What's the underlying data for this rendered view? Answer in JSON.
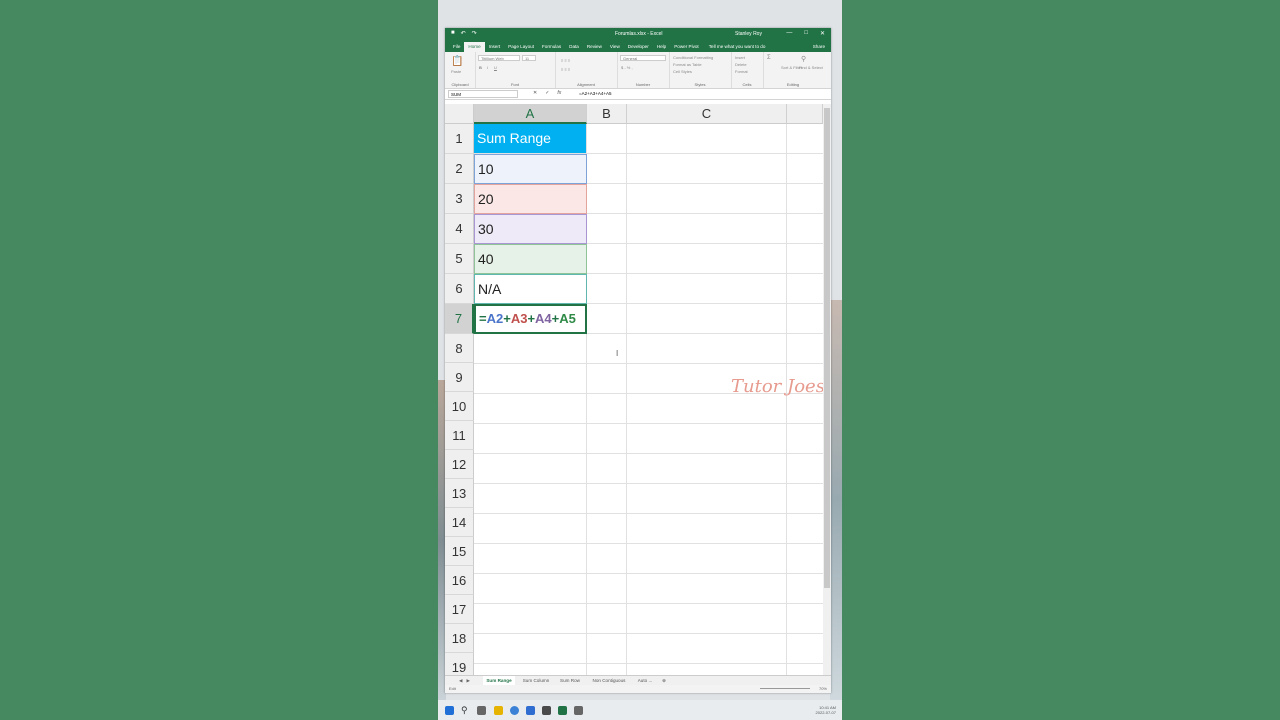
{
  "window": {
    "title": "Forumlas.xlsx - Excel",
    "user": "Stanley Roy",
    "controls": [
      "—",
      "□",
      "✕"
    ]
  },
  "ribbon_tabs": [
    "File",
    "Home",
    "Insert",
    "Page Layout",
    "Formulas",
    "Data",
    "Review",
    "View",
    "Developer",
    "Help",
    "Power Pivot"
  ],
  "active_tab": "Home",
  "tell_me": "Tell me what you want to do",
  "share": "Share",
  "ribbon": {
    "groups": [
      "Clipboard",
      "Font",
      "Alignment",
      "Number",
      "Styles",
      "Cells",
      "Editing"
    ],
    "paste_label": "Paste",
    "font_name": "Titillium Web",
    "font_size": "11",
    "number_format": "General",
    "styles_items": [
      "Conditional Formatting",
      "Format as Table",
      "Cell Styles"
    ],
    "cells_items": [
      "Insert",
      "Delete",
      "Format"
    ],
    "editing_sort": "Sort & Filter",
    "editing_find": "Find & Select"
  },
  "formula_bar": {
    "name_box": "SUM",
    "formula": "=A2+A3+A4+A5"
  },
  "columns": [
    "A",
    "B",
    "C"
  ],
  "rows": [
    "1",
    "2",
    "3",
    "4",
    "5",
    "6",
    "7",
    "8",
    "9",
    "10",
    "11",
    "12",
    "13",
    "14",
    "15",
    "16",
    "17",
    "18",
    "19"
  ],
  "cells": {
    "a1": "Sum Range",
    "a2": "10",
    "a3": "20",
    "a4": "30",
    "a5": "40",
    "a6": "N/A"
  },
  "a7_formula": {
    "eq": "=",
    "ref1": "A2",
    "ref2": "A3",
    "ref3": "A4",
    "ref4": "A5",
    "plus": "+"
  },
  "watermark": "Tutor Joes",
  "sheet_tabs": [
    "Sum Range",
    "Sum Column",
    "Sum Row",
    "Non Contiguous",
    "Auto ..."
  ],
  "active_sheet": "Sum Range",
  "status": {
    "mode": "Edit",
    "zoom": "70%"
  },
  "clock": {
    "time": "10:41 AM",
    "date": "2022-07-07"
  },
  "colors": {
    "excel_green": "#217346",
    "header_fill": "#00b0f0",
    "background": "#468860"
  }
}
